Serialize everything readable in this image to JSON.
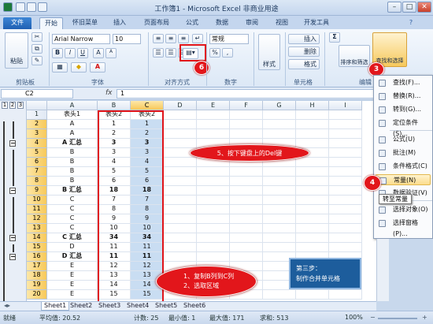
{
  "window": {
    "title": "工作簿1 - Microsoft Excel 非商业用途",
    "controls": [
      "–",
      "□",
      "✕"
    ]
  },
  "tabs": [
    "文件",
    "开始",
    "怀旧菜单",
    "插入",
    "页面布局",
    "公式",
    "数据",
    "审阅",
    "视图",
    "开发工具"
  ],
  "ribbon": {
    "clipboard": {
      "paste": "粘贴",
      "label": "剪贴板"
    },
    "font": {
      "name": "Arial Narrow",
      "size": "10",
      "bold": "B",
      "italic": "I",
      "underline": "U",
      "grow": "A",
      "shrink": "A",
      "label": "字体"
    },
    "alignment": {
      "label": "对齐方式"
    },
    "number": {
      "format": "常规",
      "percent": "%",
      "comma": ",",
      "label": "数字"
    },
    "styles": {
      "label": "样式"
    },
    "cells": {
      "insert": "插入",
      "delete": "删除",
      "format": "格式",
      "label": "单元格"
    },
    "editing": {
      "sigma": "Σ",
      "sort": "排序和筛选",
      "find": "查找和选择",
      "label": "编辑"
    }
  },
  "formula_bar": {
    "name_box": "C2",
    "fx": "fx",
    "value": "1"
  },
  "columns": [
    "A",
    "B",
    "C",
    "D",
    "E",
    "F",
    "G",
    "H",
    "I"
  ],
  "outline_levels": [
    "1",
    "2",
    "3"
  ],
  "rows": [
    {
      "n": "1",
      "a": "表头1",
      "b": "表头2",
      "c": "表头2",
      "bold": false
    },
    {
      "n": "2",
      "a": "A",
      "b": "1",
      "c": "1",
      "bold": false
    },
    {
      "n": "3",
      "a": "A",
      "b": "2",
      "c": "2",
      "bold": false
    },
    {
      "n": "4",
      "a": "A 汇总",
      "b": "3",
      "c": "3",
      "bold": true
    },
    {
      "n": "5",
      "a": "B",
      "b": "3",
      "c": "3",
      "bold": false
    },
    {
      "n": "6",
      "a": "B",
      "b": "4",
      "c": "4",
      "bold": false
    },
    {
      "n": "7",
      "a": "B",
      "b": "5",
      "c": "5",
      "bold": false
    },
    {
      "n": "8",
      "a": "B",
      "b": "6",
      "c": "6",
      "bold": false
    },
    {
      "n": "9",
      "a": "B 汇总",
      "b": "18",
      "c": "18",
      "bold": true
    },
    {
      "n": "10",
      "a": "C",
      "b": "7",
      "c": "7",
      "bold": false
    },
    {
      "n": "11",
      "a": "C",
      "b": "8",
      "c": "8",
      "bold": false
    },
    {
      "n": "12",
      "a": "C",
      "b": "9",
      "c": "9",
      "bold": false
    },
    {
      "n": "13",
      "a": "C",
      "b": "10",
      "c": "10",
      "bold": false
    },
    {
      "n": "14",
      "a": "C 汇总",
      "b": "34",
      "c": "34",
      "bold": true
    },
    {
      "n": "15",
      "a": "D",
      "b": "11",
      "c": "11",
      "bold": false
    },
    {
      "n": "16",
      "a": "D 汇总",
      "b": "11",
      "c": "11",
      "bold": true
    },
    {
      "n": "17",
      "a": "E",
      "b": "12",
      "c": "12",
      "bold": false
    },
    {
      "n": "18",
      "a": "E",
      "b": "13",
      "c": "13",
      "bold": false
    },
    {
      "n": "19",
      "a": "E",
      "b": "14",
      "c": "14",
      "bold": false
    },
    {
      "n": "20",
      "a": "E",
      "b": "15",
      "c": "15",
      "bold": false
    }
  ],
  "context_menu": [
    {
      "label": "查找(F)...",
      "sep_after": false
    },
    {
      "label": "替换(R)...",
      "sep_after": false
    },
    {
      "label": "转到(G)...",
      "sep_after": false
    },
    {
      "label": "定位条件(S)...",
      "sep_after": true
    },
    {
      "label": "公式(U)",
      "sep_after": false
    },
    {
      "label": "批注(M)",
      "sep_after": false
    },
    {
      "label": "条件格式(C)",
      "sep_after": false
    },
    {
      "label": "常量(N)",
      "sep_after": false
    },
    {
      "label": "数据验证(V)",
      "sep_after": true
    },
    {
      "label": "选择对象(O)",
      "sep_after": false
    },
    {
      "label": "选择窗格(P)...",
      "sep_after": false
    }
  ],
  "tooltip": "转至常量",
  "annotations": {
    "step3": "3",
    "step4": "4",
    "step6": "6",
    "step5": "5、按下键盘上的Del键",
    "step12_line1": "1、复制B列到C列",
    "step12_line2": "2、选取区域",
    "step_box_line1": "第三步：",
    "step_box_line2": "制作合并单元格"
  },
  "sheet_tabs": [
    "Sheet1",
    "Sheet2",
    "Sheet3",
    "Sheet4",
    "Sheet5",
    "Sheet6"
  ],
  "status": {
    "ready": "就绪",
    "average": "平均值: 20.52",
    "count": "计数: 25",
    "min": "最小值: 1",
    "max": "最大值: 171",
    "sum": "求和: 513",
    "zoom": "100%"
  },
  "colors": {
    "accent_red": "#e2161b",
    "selection": "#c9ddf2",
    "file_tab": "#2a6fc4"
  }
}
